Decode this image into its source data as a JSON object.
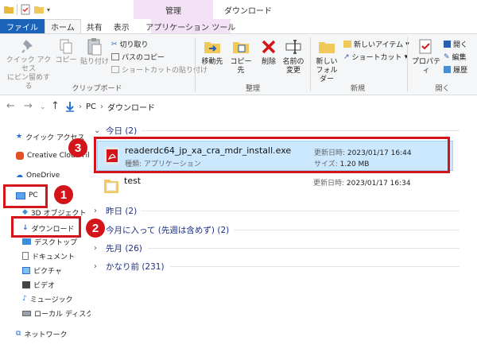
{
  "window": {
    "title": "ダウンロード",
    "context_tab": "管理"
  },
  "tabs": [
    {
      "label": "ファイル"
    },
    {
      "label": "ホーム"
    },
    {
      "label": "共有"
    },
    {
      "label": "表示"
    },
    {
      "label": "アプリケーション ツール"
    }
  ],
  "ribbon": {
    "clipboard": {
      "label": "クリップボード",
      "pin": "クイック アクセス\nにピン留めする",
      "copy": "コピー",
      "paste": "貼り付け",
      "cut": "切り取り",
      "copy_path": "パスのコピー",
      "paste_shortcut": "ショートカットの貼り付け"
    },
    "organize": {
      "label": "整理",
      "move_to": "移動先",
      "copy_to": "コピー先",
      "delete": "削除",
      "rename": "名前の\n変更"
    },
    "new": {
      "label": "新規",
      "new_folder": "新しい\nフォルダー",
      "new_item": "新しいアイテム",
      "shortcut": "ショートカット"
    },
    "open": {
      "label": "開く",
      "properties": "プロパティ",
      "open": "開く",
      "edit": "編集",
      "history": "履歴"
    }
  },
  "address": {
    "path": [
      "PC",
      "ダウンロード"
    ]
  },
  "navpane": {
    "items": [
      {
        "label": "クイック アクセス"
      },
      {
        "label": "Creative Cloud Fil"
      },
      {
        "label": "OneDrive"
      },
      {
        "label": "PC"
      },
      {
        "label": "3D オブジェクト"
      },
      {
        "label": "ダウンロード"
      },
      {
        "label": "デスクトップ"
      },
      {
        "label": "ドキュメント"
      },
      {
        "label": "ピクチャ"
      },
      {
        "label": "ビデオ"
      },
      {
        "label": "ミュージック"
      },
      {
        "label": "ローカル ディスク (C:"
      },
      {
        "label": "ネットワーク"
      }
    ]
  },
  "content": {
    "groups": [
      {
        "label": "今日 (2)"
      },
      {
        "label": "昨日 (2)"
      },
      {
        "label": "今月に入って (先週は含めず) (2)"
      },
      {
        "label": "先月 (26)"
      },
      {
        "label": "かなり前 (231)"
      }
    ],
    "files": [
      {
        "name": "readerdc64_jp_xa_cra_mdr_install.exe",
        "kind": "種類: アプリケーション",
        "date_label": "更新日時:",
        "date": "2023/01/17 16:44",
        "size_label": "サイズ:",
        "size": "1.20 MB"
      },
      {
        "name": "test",
        "date_label": "更新日時:",
        "date": "2023/01/17 16:34"
      }
    ]
  },
  "callouts": [
    "1",
    "2",
    "3"
  ],
  "colors": {
    "accent": "#1b63b8",
    "callout_red": "#d3141a",
    "selection": "#cce8ff",
    "context_tab": "#f3e1f5",
    "group_header": "#1e3287"
  }
}
